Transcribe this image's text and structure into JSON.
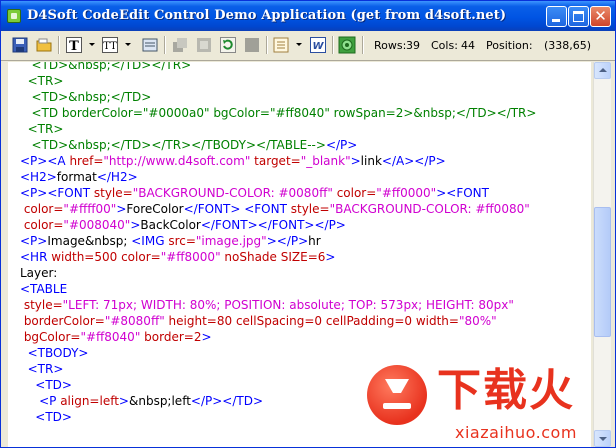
{
  "window": {
    "title": "D4Soft CodeEdit Control Demo Application (get from d4soft.net)",
    "close_glyph": "✕"
  },
  "status": {
    "rows_label": "Rows:",
    "rows_value": "39",
    "cols_label": "Cols:",
    "cols_value": "44",
    "position_label": "Position:",
    "position_value": "(338,65)"
  },
  "toolbar_icons": [
    "save-icon",
    "open-folder-icon",
    "text-T-icon",
    "font-icon",
    "edit-icon",
    "disabled-icon",
    "disabled-icon",
    "refresh-icon",
    "disabled-icon",
    "list-icon",
    "word-icon",
    "gear-icon"
  ],
  "editor": {
    "lines": [
      [
        {
          "c": "g",
          "t": "   <TD>&nbsp;</TD></TR>"
        }
      ],
      [
        {
          "c": "g",
          "t": "  <TR>"
        }
      ],
      [
        {
          "c": "g",
          "t": "   <TD>&nbsp;</TD>"
        }
      ],
      [
        {
          "c": "g",
          "t": "   <TD borderColor=\"#0000a0\" bgColor=\"#ff8040\" rowSpan=2>&nbsp;</TD></TR>"
        }
      ],
      [
        {
          "c": "g",
          "t": "  <TR>"
        }
      ],
      [
        {
          "c": "g",
          "t": "   <TD>&nbsp;</TD></TR></TBODY></TABLE-->"
        },
        {
          "c": "b",
          "t": "</P>"
        }
      ],
      [
        {
          "c": "b",
          "t": "<P><A "
        },
        {
          "c": "r",
          "t": "href="
        },
        {
          "c": "m",
          "t": "\"http://www.d4soft.com\""
        },
        {
          "c": "r",
          "t": " target="
        },
        {
          "c": "m",
          "t": "\"_blank\""
        },
        {
          "c": "b",
          "t": ">"
        },
        {
          "c": "bk",
          "t": "link"
        },
        {
          "c": "b",
          "t": "</A></P>"
        }
      ],
      [
        {
          "c": "b",
          "t": "<H2>"
        },
        {
          "c": "bk",
          "t": "format"
        },
        {
          "c": "b",
          "t": "</H2>"
        }
      ],
      [
        {
          "c": "b",
          "t": "<P><FONT "
        },
        {
          "c": "r",
          "t": "style="
        },
        {
          "c": "m",
          "t": "\"BACKGROUND-COLOR: #0080ff\""
        },
        {
          "c": "r",
          "t": " color="
        },
        {
          "c": "m",
          "t": "\"#ff0000\""
        },
        {
          "c": "b",
          "t": "><FONT"
        }
      ],
      [
        {
          "c": "r",
          "t": " color="
        },
        {
          "c": "m",
          "t": "\"#ffff00\""
        },
        {
          "c": "b",
          "t": ">"
        },
        {
          "c": "bk",
          "t": "ForeColor"
        },
        {
          "c": "b",
          "t": "</FONT> <FONT "
        },
        {
          "c": "r",
          "t": "style="
        },
        {
          "c": "m",
          "t": "\"BACKGROUND-COLOR: #ff0080\""
        }
      ],
      [
        {
          "c": "r",
          "t": " color="
        },
        {
          "c": "m",
          "t": "\"#008040\""
        },
        {
          "c": "b",
          "t": ">"
        },
        {
          "c": "bk",
          "t": "BackColor"
        },
        {
          "c": "b",
          "t": "</FONT></FONT></P>"
        }
      ],
      [
        {
          "c": "b",
          "t": "<P>"
        },
        {
          "c": "bk",
          "t": "Image&nbsp; "
        },
        {
          "c": "b",
          "t": "<IMG "
        },
        {
          "c": "r",
          "t": "src="
        },
        {
          "c": "m",
          "t": "\"image.jpg\""
        },
        {
          "c": "b",
          "t": "></P>"
        },
        {
          "c": "bk",
          "t": "hr"
        }
      ],
      [
        {
          "c": "b",
          "t": "<HR "
        },
        {
          "c": "r",
          "t": "width=500 color="
        },
        {
          "c": "m",
          "t": "\"#ff8000\""
        },
        {
          "c": "r",
          "t": " noShade SIZE=6"
        },
        {
          "c": "b",
          "t": ">"
        }
      ],
      [
        {
          "c": "bk",
          "t": "Layer:"
        }
      ],
      [
        {
          "c": "b",
          "t": "<TABLE"
        }
      ],
      [
        {
          "c": "r",
          "t": " style="
        },
        {
          "c": "m",
          "t": "\"LEFT: 71px; WIDTH: 80%; POSITION: absolute; TOP: 573px; HEIGHT: 80px\""
        }
      ],
      [
        {
          "c": "r",
          "t": " borderColor="
        },
        {
          "c": "m",
          "t": "\"#8080ff\""
        },
        {
          "c": "r",
          "t": " height=80 cellSpacing=0 cellPadding=0 width="
        },
        {
          "c": "m",
          "t": "\"80%\""
        }
      ],
      [
        {
          "c": "r",
          "t": " bgColor="
        },
        {
          "c": "m",
          "t": "\"#ff8040\""
        },
        {
          "c": "r",
          "t": " border=2"
        },
        {
          "c": "b",
          "t": ">"
        }
      ],
      [
        {
          "c": "b",
          "t": "  <TBODY>"
        }
      ],
      [
        {
          "c": "b",
          "t": "  <TR>"
        }
      ],
      [
        {
          "c": "b",
          "t": "    <TD>"
        }
      ],
      [
        {
          "c": "b",
          "t": "     <P "
        },
        {
          "c": "r",
          "t": "align=left"
        },
        {
          "c": "b",
          "t": ">"
        },
        {
          "c": "bk",
          "t": "&nbsp;left"
        },
        {
          "c": "b",
          "t": "</P></TD>"
        }
      ],
      [
        {
          "c": "b",
          "t": "    <TD>"
        }
      ]
    ]
  },
  "watermark": {
    "chinese": "下载火",
    "url": "xiazaihuo.com"
  }
}
